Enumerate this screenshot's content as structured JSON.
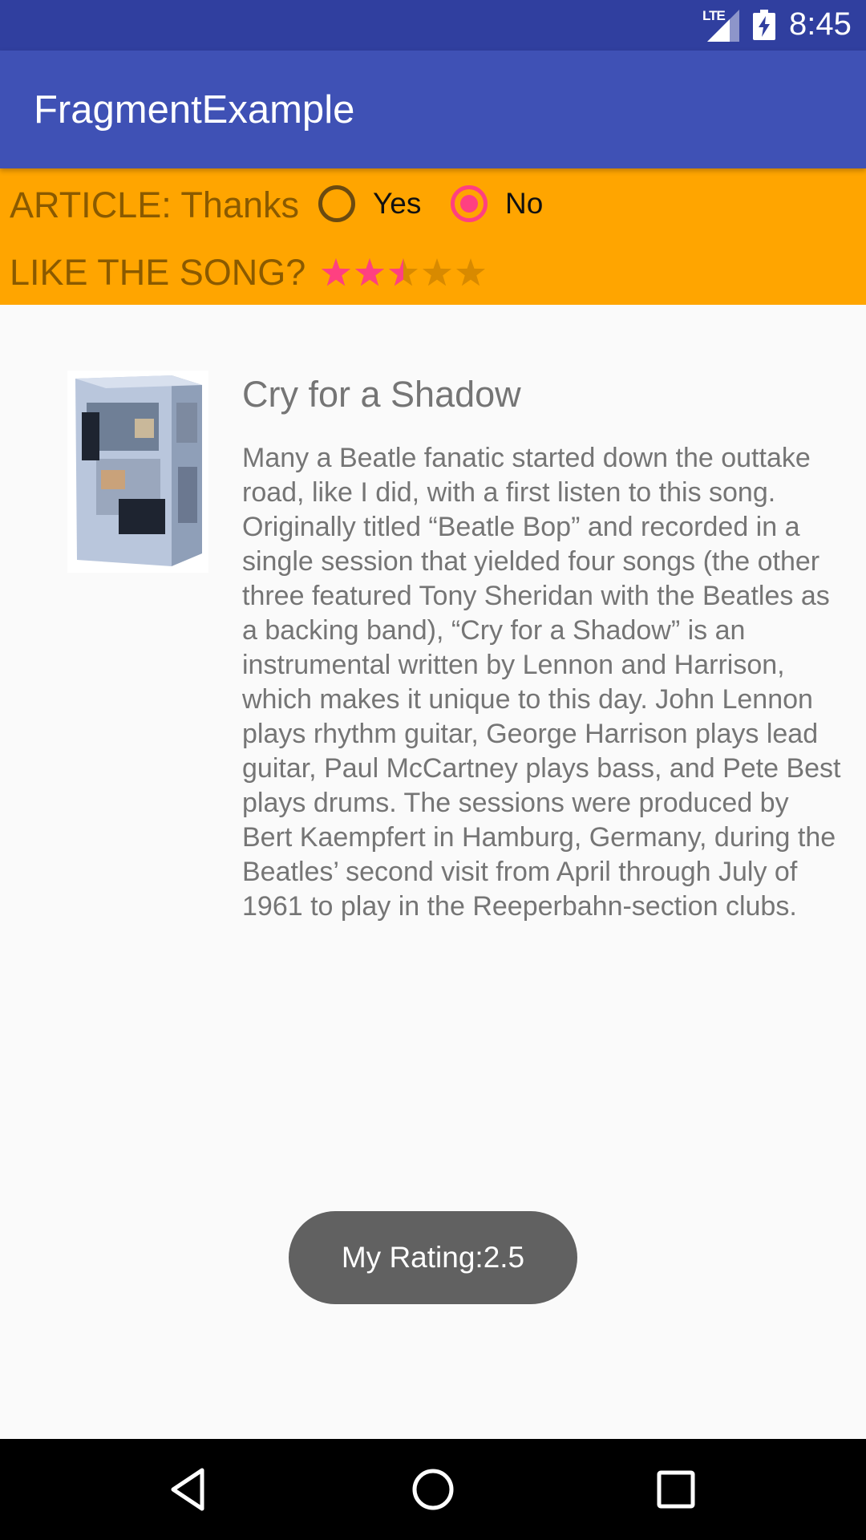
{
  "status_bar": {
    "network": "LTE",
    "time": "8:45",
    "icons": [
      "signal-icon",
      "battery-charging-icon"
    ]
  },
  "app_bar": {
    "title": "FragmentExample"
  },
  "header": {
    "article_label": "ARTICLE: Thanks",
    "radio_options": [
      {
        "label": "Yes",
        "checked": false
      },
      {
        "label": "No",
        "checked": true
      }
    ],
    "like_label": "LIKE THE SONG?",
    "rating": 2.5,
    "rating_max": 5
  },
  "article": {
    "title": "Cry for a Shadow",
    "body": "Many a Beatle fanatic started down the outtake road, like I did, with a first listen to this song. Originally titled “Beatle Bop” and recorded in a single session that yielded four songs (the other three featured Tony Sheridan with the Beatles as a backing band), “Cry for a Shadow” is an instrumental written by Lennon and Harrison, which makes it unique to this day. John Lennon plays rhythm guitar, George Harrison plays lead guitar, Paul McCartney plays bass, and Pete Best plays drums. The sessions were produced by Bert Kaempfert in Hamburg, Germany, during the Beatles’ second visit from April through July of 1961 to play in the Reeperbahn-section clubs.",
    "image_icon": "album-cover-image"
  },
  "toast": {
    "text": "My Rating:2.5"
  },
  "nav_bar": {
    "icons": [
      "back-icon",
      "home-icon",
      "recents-icon"
    ]
  },
  "colors": {
    "status_bar": "#303f9f",
    "app_bar": "#3f51b5",
    "header_bg": "#ffa500",
    "accent": "#ff4081",
    "toast_bg": "#616161"
  }
}
